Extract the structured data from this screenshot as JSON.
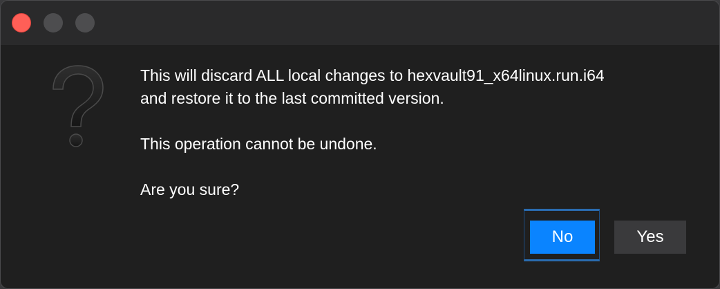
{
  "dialog": {
    "icon": "question-mark-icon",
    "message_line1": "This will discard ALL local changes to hexvault91_x64linux.run.i64",
    "message_line2": "and restore it to the last committed version.",
    "warning": "This operation cannot be undone.",
    "prompt": "Are you sure?",
    "buttons": {
      "no_label": "No",
      "yes_label": "Yes"
    },
    "default_button": "No"
  },
  "colors": {
    "accent": "#0a84ff",
    "close": "#ff5f57",
    "background": "#1f1f1f",
    "titlebar": "#2a2a2b"
  }
}
